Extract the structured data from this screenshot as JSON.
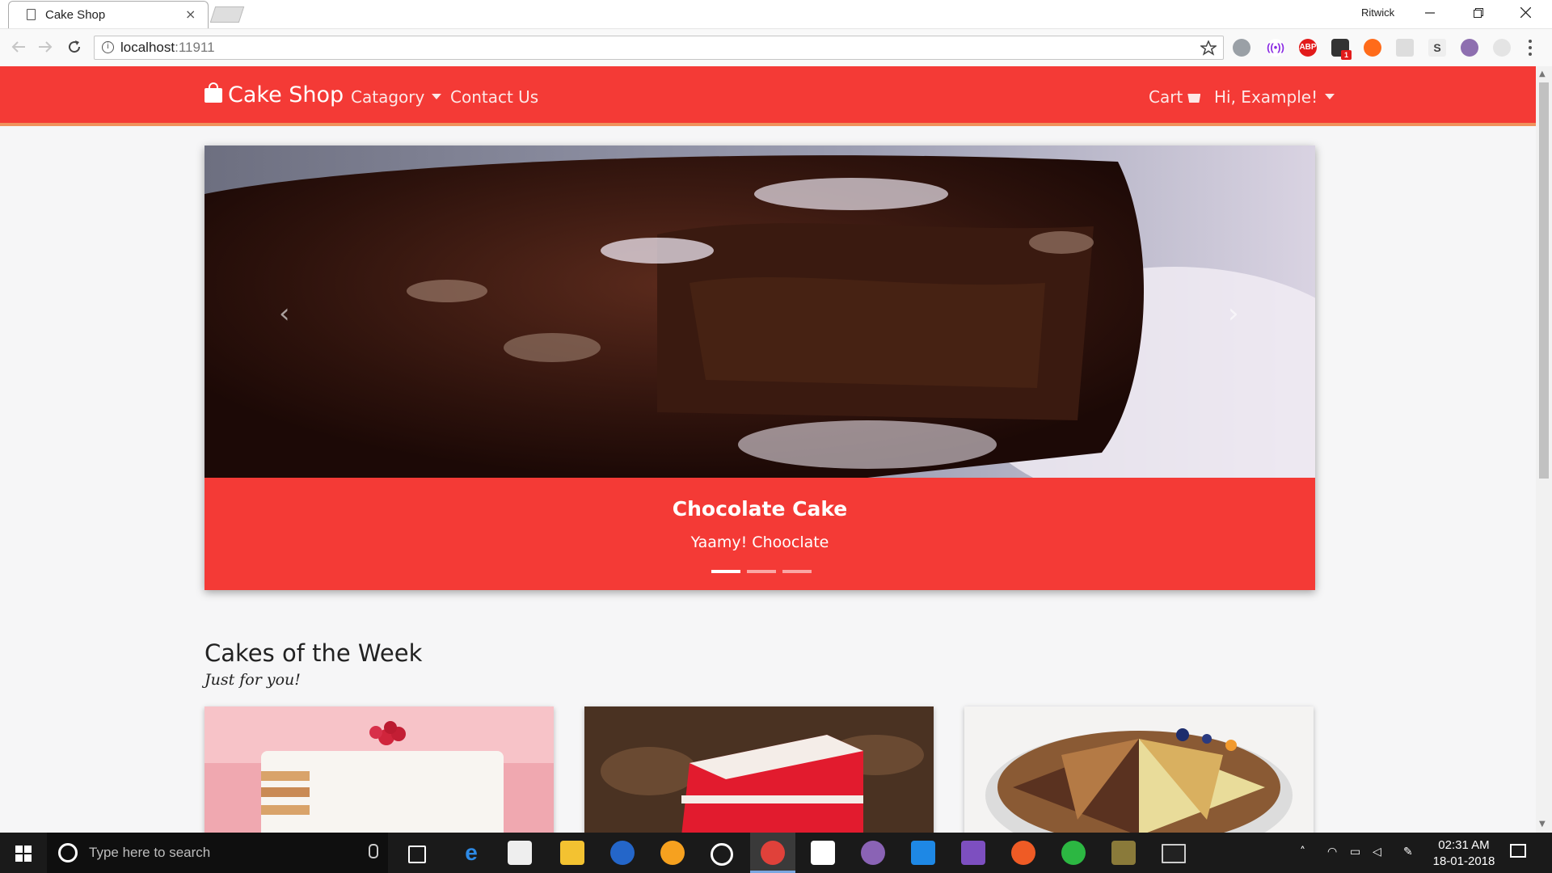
{
  "browser": {
    "tab_title": "Cake Shop",
    "tab_close": "×",
    "profile_name": "Ritwick",
    "url_host": "localhost",
    "url_port": ":11911",
    "info_glyph": "i",
    "extensions": [
      "cloud-sync-icon",
      "broadcast-icon",
      "adblock-plus-icon",
      "notification-icon",
      "orange-circle-icon",
      "grey-square-icon",
      "s-icon",
      "octocat-icon",
      "grey-person-icon"
    ],
    "adblock_label": "ABP",
    "notification_count": "1",
    "s_label": "S"
  },
  "site": {
    "brand": "Cake Shop",
    "nav": {
      "category": "Catagory",
      "contact": "Contact Us",
      "cart": "Cart",
      "user": "Hi, Example!"
    },
    "colors": {
      "primary": "#f43a36",
      "accent": "#f0925c",
      "background": "#f6f6f7"
    }
  },
  "carousel": {
    "slide_title": "Chocolate Cake",
    "slide_subtitle": "Yaamy! Chooclate",
    "prev_glyph": "‹",
    "next_glyph": "›",
    "indicator_count": 3,
    "active_indicator": 1
  },
  "section": {
    "title": "Cakes of the Week",
    "subtitle": "Just for you!",
    "cards": [
      "raspberry-layer-cake",
      "red-velvet-cake",
      "assorted-cheesecake"
    ]
  },
  "taskbar": {
    "search_placeholder": "Type here to search",
    "time": "02:31 AM",
    "date": "18-01-2018",
    "pinned_apps": [
      "task-view",
      "edge",
      "store",
      "file-explorer",
      "firefox",
      "chrome-canary",
      "groove",
      "chrome",
      "movie-maker",
      "github-desktop",
      "vscode",
      "visual-studio",
      "postman",
      "whatsapp",
      "build-tool",
      "terminal"
    ]
  }
}
